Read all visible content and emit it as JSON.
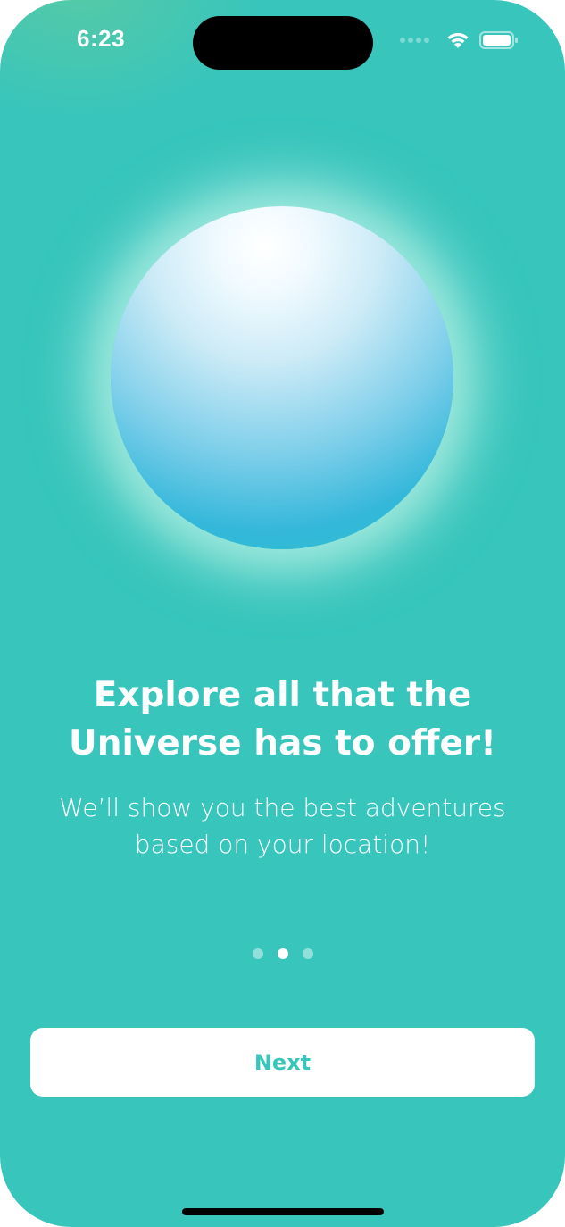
{
  "status_bar": {
    "time": "6:23",
    "icons": [
      "cellular-signal-icon",
      "wifi-icon",
      "battery-icon"
    ]
  },
  "onboarding": {
    "headline": "Explore all that the Universe has to offer!",
    "subline": "We’ll show you the best adventures based on your location!",
    "page_count": 3,
    "active_page": 2
  },
  "actions": {
    "next_label": "Next"
  },
  "colors": {
    "background": "#37c5bc",
    "accent": "#37c5bc",
    "button_bg": "#ffffff",
    "text": "#ffffff"
  }
}
